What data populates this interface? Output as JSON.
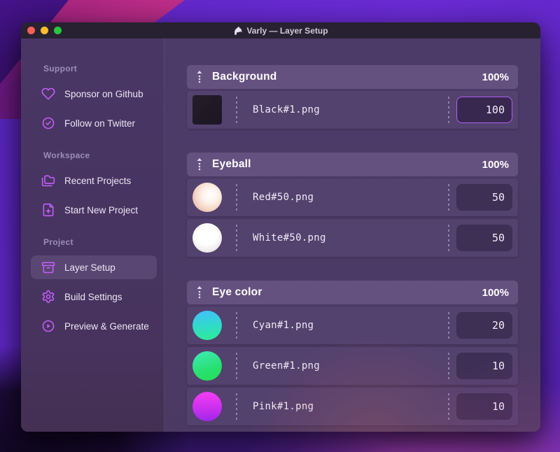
{
  "window": {
    "title": "Varly — Layer Setup",
    "title_icon": "unicorn-icon",
    "controls": [
      "close",
      "minimize",
      "zoom"
    ]
  },
  "sidebar": {
    "sections": [
      {
        "label": "Support",
        "items": [
          {
            "icon": "heart-icon",
            "label": "Sponsor on Github"
          },
          {
            "icon": "badge-check-icon",
            "label": "Follow on Twitter"
          }
        ]
      },
      {
        "label": "Workspace",
        "items": [
          {
            "icon": "folders-icon",
            "label": "Recent Projects"
          },
          {
            "icon": "file-plus-icon",
            "label": "Start New Project"
          }
        ]
      },
      {
        "label": "Project",
        "items": [
          {
            "icon": "archive-icon",
            "label": "Layer Setup",
            "selected": true
          },
          {
            "icon": "gear-icon",
            "label": "Build Settings"
          },
          {
            "icon": "play-circle-icon",
            "label": "Preview & Generate"
          }
        ]
      }
    ]
  },
  "layers": {
    "groups": [
      {
        "name": "Background",
        "weight": "100%",
        "items": [
          {
            "file": "Black#1.png",
            "value": "100",
            "thumb": "black-swatch",
            "focused": true
          }
        ]
      },
      {
        "name": "Eyeball",
        "weight": "100%",
        "items": [
          {
            "file": "Red#50.png",
            "value": "50",
            "thumb": "red-sphere"
          },
          {
            "file": "White#50.png",
            "value": "50",
            "thumb": "white-sphere"
          }
        ]
      },
      {
        "name": "Eye color",
        "weight": "100%",
        "items": [
          {
            "file": "Cyan#1.png",
            "value": "20",
            "thumb": "cyan-sphere"
          },
          {
            "file": "Green#1.png",
            "value": "10",
            "thumb": "green-sphere"
          },
          {
            "file": "Pink#1.png",
            "value": "10",
            "thumb": "pink-sphere"
          }
        ]
      }
    ]
  },
  "colors": {
    "accent_purple": "#bf5af2",
    "focus_border": "#b35ef2",
    "titlebar": "#272131",
    "group_header": "#65517f",
    "row": "#53416e",
    "traffic_close": "#ff5f57",
    "traffic_minimize": "#febc2e",
    "traffic_zoom": "#28c840"
  }
}
